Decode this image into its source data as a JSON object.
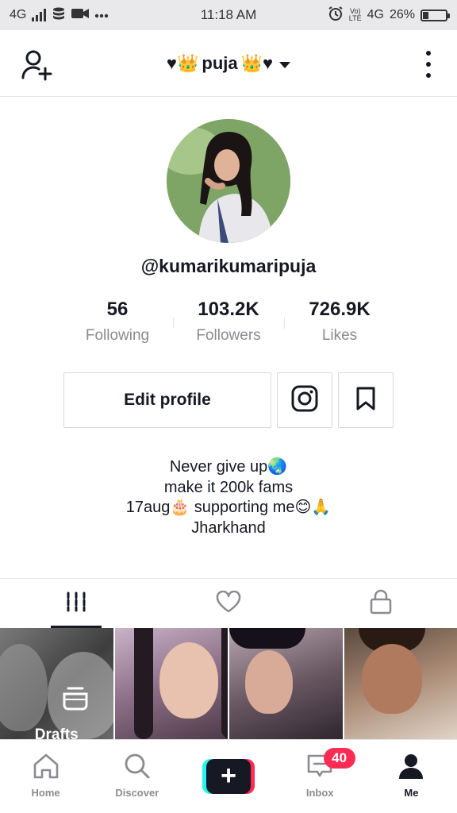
{
  "status_bar": {
    "network_left": "4G",
    "time": "11:18 AM",
    "volte_label_top": "Vo)",
    "volte_label_bottom": "LTE",
    "network_right": "4G",
    "battery_percent": "26%",
    "battery_level": 0.26
  },
  "header": {
    "title_prefix": "♥👑",
    "title_name": "puja",
    "title_suffix": "👑♥",
    "add_user_icon": "add-user-icon",
    "more_icon": "more-vertical-icon"
  },
  "profile": {
    "handle": "@kumarikumaripuja",
    "stats": [
      {
        "value": "56",
        "label": "Following"
      },
      {
        "value": "103.2K",
        "label": "Followers"
      },
      {
        "value": "726.9K",
        "label": "Likes"
      }
    ],
    "edit_profile_label": "Edit profile",
    "instagram_icon": "instagram-icon",
    "bookmark_icon": "bookmark-icon",
    "bio_lines": [
      "Never give up🌏",
      "make it 200k fams",
      "17aug🎂 supporting me😊🙏",
      "Jharkhand"
    ]
  },
  "tabs": [
    {
      "icon": "videos-grid-icon",
      "active": true
    },
    {
      "icon": "heart-icon",
      "active": false
    },
    {
      "icon": "lock-icon",
      "active": false
    }
  ],
  "videos": {
    "drafts_label": "Drafts"
  },
  "bottom_nav": {
    "items": [
      {
        "label": "Home",
        "icon": "home-icon"
      },
      {
        "label": "Discover",
        "icon": "search-icon"
      },
      {
        "label": "",
        "icon": "plus-icon"
      },
      {
        "label": "Inbox",
        "icon": "inbox-icon",
        "badge": "40"
      },
      {
        "label": "Me",
        "icon": "profile-icon"
      }
    ]
  },
  "colors": {
    "text": "#161823",
    "secondary_text": "#8a8b91",
    "accent_red": "#fe2c55",
    "accent_cyan": "#25f4ee",
    "status_bar_bg": "#e9e9eb"
  }
}
